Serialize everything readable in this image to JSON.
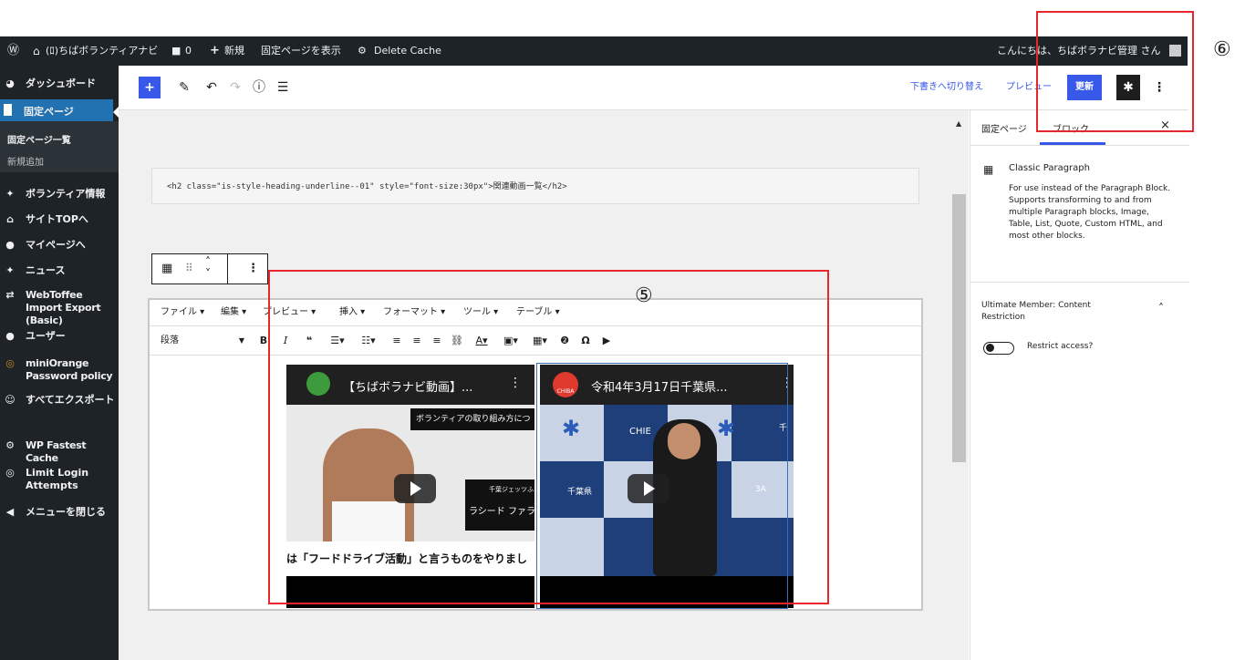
{
  "adminbar": {
    "site_name": "(ﾛ)ちばボランティアナビ",
    "comments_count": "0",
    "new_label": "新規",
    "view_page_label": "固定ページを表示",
    "delete_cache_label": "Delete Cache",
    "greeting": "こんにちは、ちばボラナビ管理 さん"
  },
  "sidebar": {
    "items": [
      {
        "label": "ダッシュボード",
        "icon": "dashboard-icon"
      },
      {
        "label": "固定ページ",
        "icon": "page-icon"
      },
      {
        "label": "ボランティア情報",
        "icon": "pin-icon"
      },
      {
        "label": "サイトTOPへ",
        "icon": "home-icon"
      },
      {
        "label": "マイページへ",
        "icon": "user-icon"
      },
      {
        "label": "ニュース",
        "icon": "pin-icon"
      },
      {
        "label": "WebToffee Import Export (Basic)",
        "icon": "import-icon"
      },
      {
        "label": "ユーザー",
        "icon": "users-icon"
      },
      {
        "label": "miniOrange Password policy",
        "icon": "miniorange-icon"
      },
      {
        "label": "すべてエクスポート",
        "icon": "export-icon"
      },
      {
        "label": "WP Fastest Cache",
        "icon": "cache-icon"
      },
      {
        "label": "Limit Login Attempts",
        "icon": "lock-icon"
      },
      {
        "label": "メニューを閉じる",
        "icon": "collapse-icon"
      }
    ],
    "subitems": [
      "固定ページ一覧",
      "新規追加"
    ]
  },
  "toolbar": {
    "switch_draft_label": "下書きへ切り替え",
    "preview_label": "プレビュー",
    "update_label": "更新"
  },
  "canvas": {
    "code_text": "<h2 class=\"is-style-heading-underline--01\" style=\"font-size:30px\">関連動画一覧</h2>",
    "menubar": [
      "ファイル ▾",
      "編集 ▾",
      "プレビュー ▾",
      "挿入 ▾",
      "フォーマット ▾",
      "ツール ▾",
      "テーブル ▾"
    ],
    "format_select": "段落",
    "video1": {
      "title": "【ちばボラナビ動画】...",
      "overlay1": "ボランティアの取り組み方につ",
      "overlay2": "千葉ジェッツふな",
      "overlay3": "ラシード ファラー",
      "subtitle": "は「フードドライブ活動」と言うものをやりまし"
    },
    "video2": {
      "title": "令和4年3月17日千葉県...",
      "logo_text": "CHIBA",
      "backdrop1": "CHIE",
      "backdrop2": "千葉県",
      "backdrop3": "3A",
      "backdrop4": "千"
    }
  },
  "panel": {
    "tab_page": "固定ページ",
    "tab_block": "ブロック",
    "block_name": "Classic Paragraph",
    "block_description": "For use instead of the Paragraph Block. Supports transforming to and from multiple Paragraph blocks, Image, Table, List, Quote, Custom HTML, and most other blocks.",
    "section_title": "Ultimate Member: Content Restriction",
    "toggle_label": "Restrict access?"
  },
  "annotations": {
    "label5": "⑤",
    "label6": "⑥"
  },
  "colors": {
    "admin_dark": "#1d2327",
    "wp_blue": "#3858e9",
    "annotation_red": "#e8262c"
  }
}
